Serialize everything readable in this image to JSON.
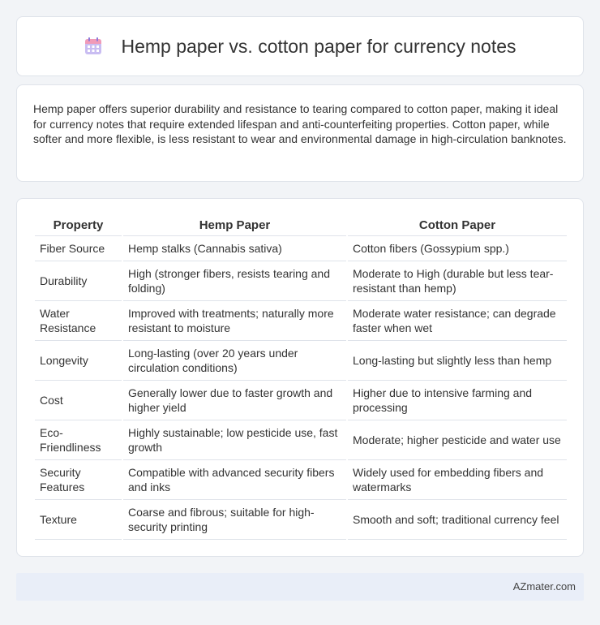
{
  "header": {
    "title": "Hemp paper vs. cotton paper for currency notes",
    "icon": "calendar-icon"
  },
  "summary": "Hemp paper offers superior durability and resistance to tearing compared to cotton paper, making it ideal for currency notes that require extended lifespan and anti-counterfeiting properties. Cotton paper, while softer and more flexible, is less resistant to wear and environmental damage in high-circulation banknotes.",
  "table": {
    "headers": [
      "Property",
      "Hemp Paper",
      "Cotton Paper"
    ],
    "rows": [
      [
        "Fiber Source",
        "Hemp stalks (Cannabis sativa)",
        "Cotton fibers (Gossypium spp.)"
      ],
      [
        "Durability",
        "High (stronger fibers, resists tearing and folding)",
        "Moderate to High (durable but less tear-resistant than hemp)"
      ],
      [
        "Water Resistance",
        "Improved with treatments; naturally more resistant to moisture",
        "Moderate water resistance; can degrade faster when wet"
      ],
      [
        "Longevity",
        "Long-lasting (over 20 years under circulation conditions)",
        "Long-lasting but slightly less than hemp"
      ],
      [
        "Cost",
        "Generally lower due to faster growth and higher yield",
        "Higher due to intensive farming and processing"
      ],
      [
        "Eco-Friendliness",
        "Highly sustainable; low pesticide use, fast growth",
        "Moderate; higher pesticide and water use"
      ],
      [
        "Security Features",
        "Compatible with advanced security fibers and inks",
        "Widely used for embedding fibers and watermarks"
      ],
      [
        "Texture",
        "Coarse and fibrous; suitable for high-security printing",
        "Smooth and soft; traditional currency feel"
      ]
    ]
  },
  "footer": {
    "brand": "AZmater.com"
  },
  "colors": {
    "background": "#f2f4f7",
    "card_border": "#dfe3ea",
    "footer_bg": "#e9eef8",
    "icon_purple": "#b7a6ec",
    "icon_pink": "#f19bb8"
  }
}
